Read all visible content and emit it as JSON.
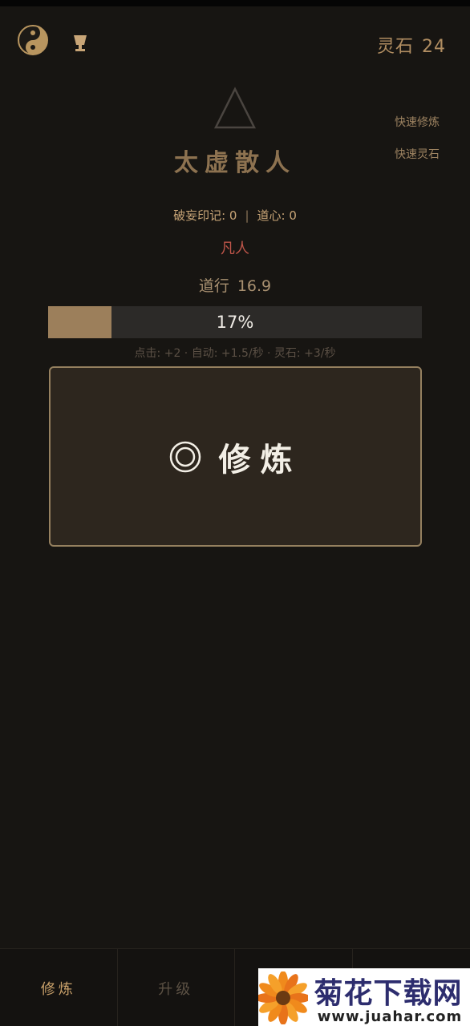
{
  "header": {
    "stone_label": "灵石",
    "stone_value": "24",
    "icons": [
      "yin-yang-icon",
      "cup-icon"
    ]
  },
  "quick_actions": {
    "train": "快速修炼",
    "stone": "快速灵石"
  },
  "character": {
    "title": "太虚散人",
    "mark_label": "破妄印记: 0",
    "separator": "|",
    "heart_label": "道心: 0",
    "realm": "凡人",
    "daoxing_label": "道行",
    "daoxing_value": "16.9"
  },
  "progress": {
    "percent_text": "17%",
    "fraction": 0.17
  },
  "rates": "点击: +2 · 自动: +1.5/秒 · 灵石: +3/秒",
  "train_button": {
    "label": "修炼",
    "icon": "double-circle-icon"
  },
  "tabs": [
    {
      "label": "修炼",
      "active": true
    },
    {
      "label": "升级",
      "active": false
    },
    {
      "label": "",
      "active": false
    },
    {
      "label": "",
      "active": false
    }
  ],
  "watermark": {
    "text": "菊花下载网",
    "url": "www.juahar.com"
  },
  "colors": {
    "background": "#171512",
    "accent": "#c8a577",
    "realm": "#c0564a",
    "progress_fill": "#9c7f5b"
  }
}
